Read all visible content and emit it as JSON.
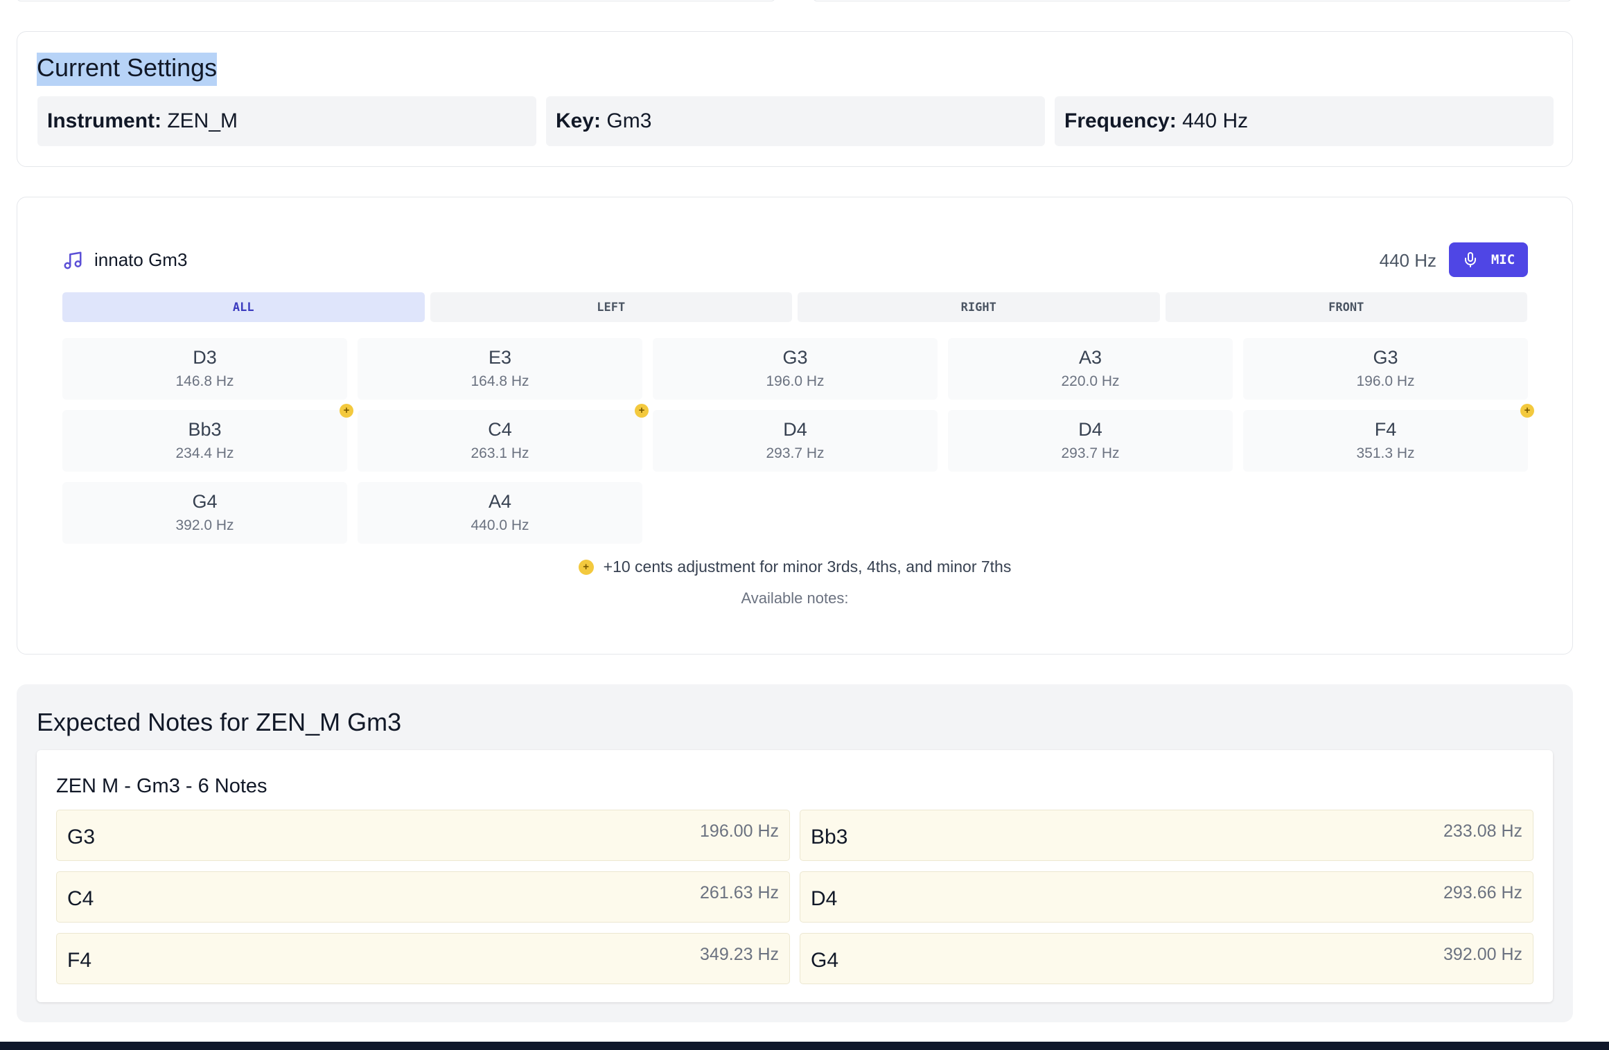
{
  "settings": {
    "title": "Current Settings",
    "instrument_label": "Instrument:",
    "instrument_value": "ZEN_M",
    "key_label": "Key:",
    "key_value": "Gm3",
    "frequency_label": "Frequency:",
    "frequency_value": "440 Hz"
  },
  "tuner": {
    "title": "innato Gm3",
    "reference": "440 Hz",
    "mic_label": "MIC",
    "tabs": [
      {
        "label": "ALL",
        "active": true
      },
      {
        "label": "LEFT",
        "active": false
      },
      {
        "label": "RIGHT",
        "active": false
      },
      {
        "label": "FRONT",
        "active": false
      }
    ],
    "notes": [
      {
        "note": "D3",
        "freq": "146.8 Hz",
        "adjusted": false
      },
      {
        "note": "E3",
        "freq": "164.8 Hz",
        "adjusted": false
      },
      {
        "note": "G3",
        "freq": "196.0 Hz",
        "adjusted": false
      },
      {
        "note": "A3",
        "freq": "220.0 Hz",
        "adjusted": false
      },
      {
        "note": "G3",
        "freq": "196.0 Hz",
        "adjusted": false
      },
      {
        "note": "Bb3",
        "freq": "234.4 Hz",
        "adjusted": true
      },
      {
        "note": "C4",
        "freq": "263.1 Hz",
        "adjusted": true
      },
      {
        "note": "D4",
        "freq": "293.7 Hz",
        "adjusted": false
      },
      {
        "note": "D4",
        "freq": "293.7 Hz",
        "adjusted": false
      },
      {
        "note": "F4",
        "freq": "351.3 Hz",
        "adjusted": true
      },
      {
        "note": "G4",
        "freq": "392.0 Hz",
        "adjusted": false
      },
      {
        "note": "A4",
        "freq": "440.0 Hz",
        "adjusted": false
      }
    ],
    "badge_symbol": "+",
    "legend": "+10 cents adjustment for minor 3rds, 4ths, and minor 7ths",
    "available": "Available notes:"
  },
  "expected": {
    "title": "Expected Notes for ZEN_M Gm3",
    "subtitle": "ZEN M - Gm3 - 6 Notes",
    "notes": [
      {
        "note": "G3",
        "freq": "196.00 Hz"
      },
      {
        "note": "Bb3",
        "freq": "233.08 Hz"
      },
      {
        "note": "C4",
        "freq": "261.63 Hz"
      },
      {
        "note": "D4",
        "freq": "293.66 Hz"
      },
      {
        "note": "F4",
        "freq": "349.23 Hz"
      },
      {
        "note": "G4",
        "freq": "392.00 Hz"
      }
    ]
  },
  "colors": {
    "accent": "#4f46e5",
    "active_tab_bg": "#dfe5fb",
    "badge": "#f3c93e",
    "expected_note_bg": "#fdfaec"
  },
  "icons": {
    "tuner_icon": "music-note-icon",
    "mic_icon": "microphone-icon"
  }
}
